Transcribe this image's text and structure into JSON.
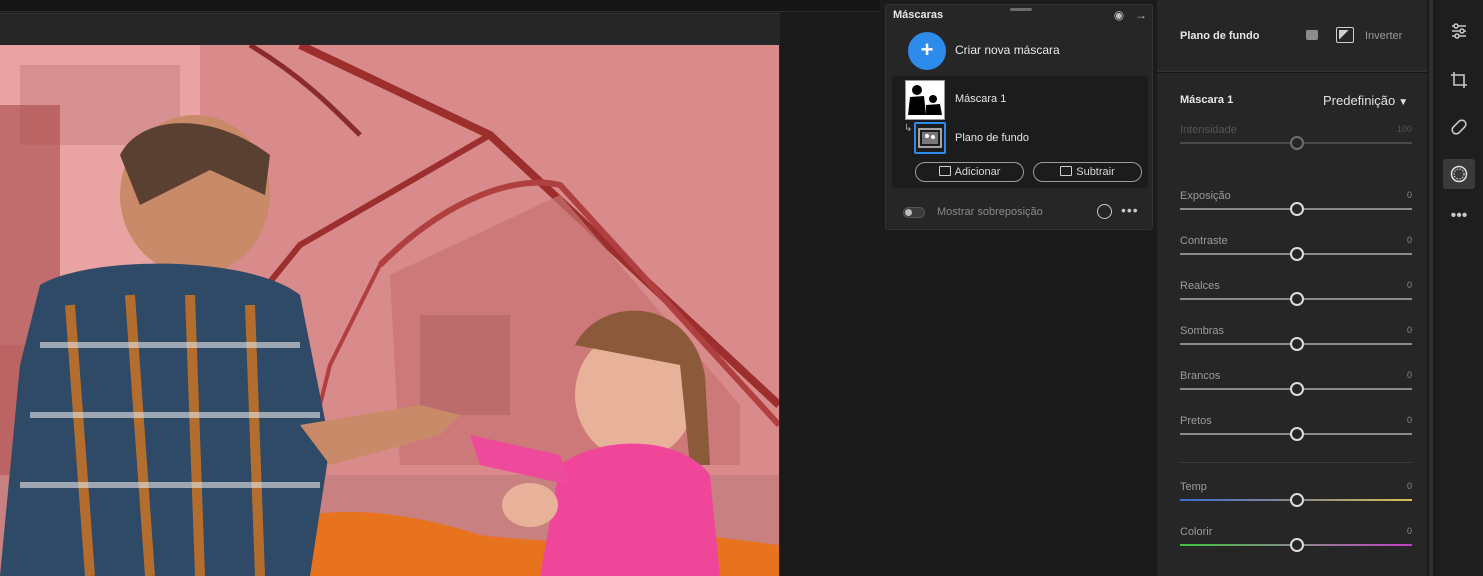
{
  "masks_panel": {
    "title": "Máscaras",
    "create_label": "Criar nova máscara",
    "mask_name": "Máscara 1",
    "sub_mask_name": "Plano de fundo",
    "add_label": "Adicionar",
    "subtract_label": "Subtrair",
    "overlay_label": "Mostrar sobreposição",
    "more": "•••"
  },
  "adjust_panel": {
    "title": "Plano de fundo",
    "invert_label": "Inverter",
    "mask_header": "Máscara 1",
    "preset_label": "Predefinição",
    "sliders": [
      {
        "label": "Intensidade",
        "value": "100"
      },
      {
        "label": "Exposição",
        "value": "0"
      },
      {
        "label": "Contraste",
        "value": "0"
      },
      {
        "label": "Realces",
        "value": "0"
      },
      {
        "label": "Sombras",
        "value": "0"
      },
      {
        "label": "Brancos",
        "value": "0"
      },
      {
        "label": "Pretos",
        "value": "0"
      },
      {
        "label": "Temp",
        "value": "0"
      },
      {
        "label": "Colorir",
        "value": "0"
      }
    ]
  },
  "tools": [
    {
      "name": "edit-sliders-icon"
    },
    {
      "name": "crop-icon"
    },
    {
      "name": "healing-icon"
    },
    {
      "name": "masking-icon"
    },
    {
      "name": "more-tools-icon"
    }
  ],
  "colors": {
    "accent": "#2d8ceb",
    "overlay_red": "#e87878"
  }
}
